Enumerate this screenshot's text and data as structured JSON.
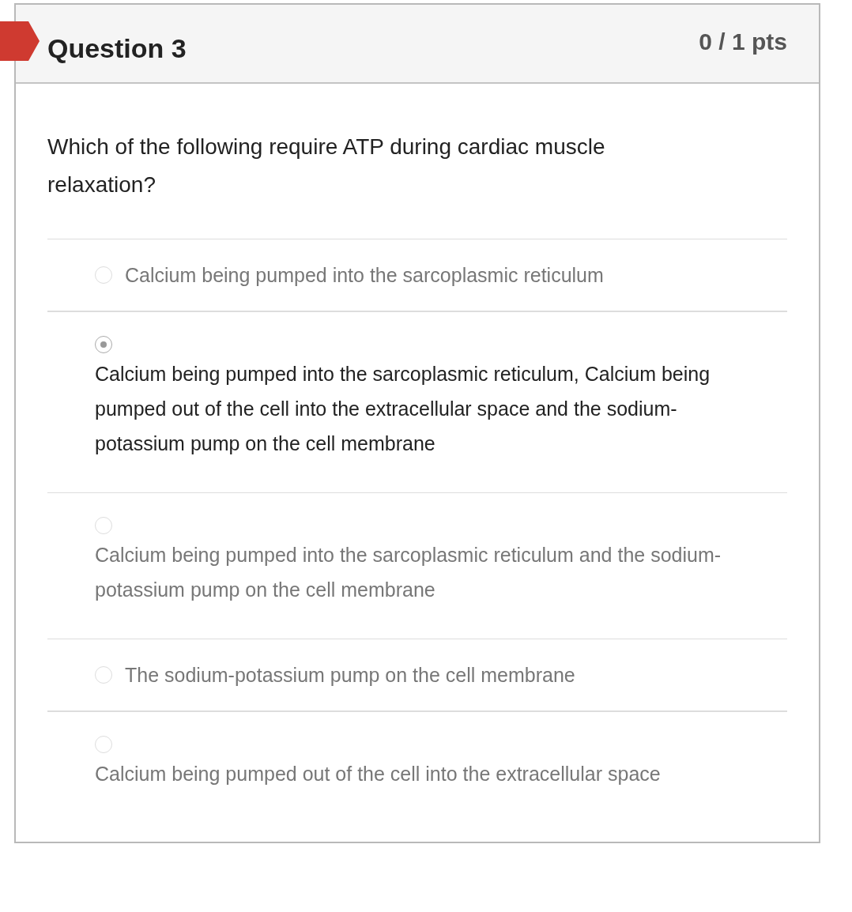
{
  "question": {
    "title": "Question 3",
    "points": "0 / 1 pts",
    "text": "Which of the following require ATP during cardiac muscle relaxation?"
  },
  "answers": [
    {
      "kind": "inline",
      "text": "Calcium being pumped into the sarcoplasmic reticulum",
      "selected": false
    },
    {
      "kind": "stacked",
      "text": "Calcium being pumped into the sarcoplasmic reticulum, Calcium being pumped out of the cell into the extracellular space and the sodium-potassium pump on the cell membrane",
      "selected": true
    },
    {
      "kind": "stacked",
      "text": "Calcium being pumped into the sarcoplasmic reticulum and the sodium-potassium pump on the cell membrane",
      "selected": false
    },
    {
      "kind": "inline",
      "text": "The sodium-potassium pump on the cell membrane",
      "selected": false
    },
    {
      "kind": "stacked",
      "text": "Calcium being pumped out of the cell into the extracellular space",
      "selected": false
    }
  ]
}
